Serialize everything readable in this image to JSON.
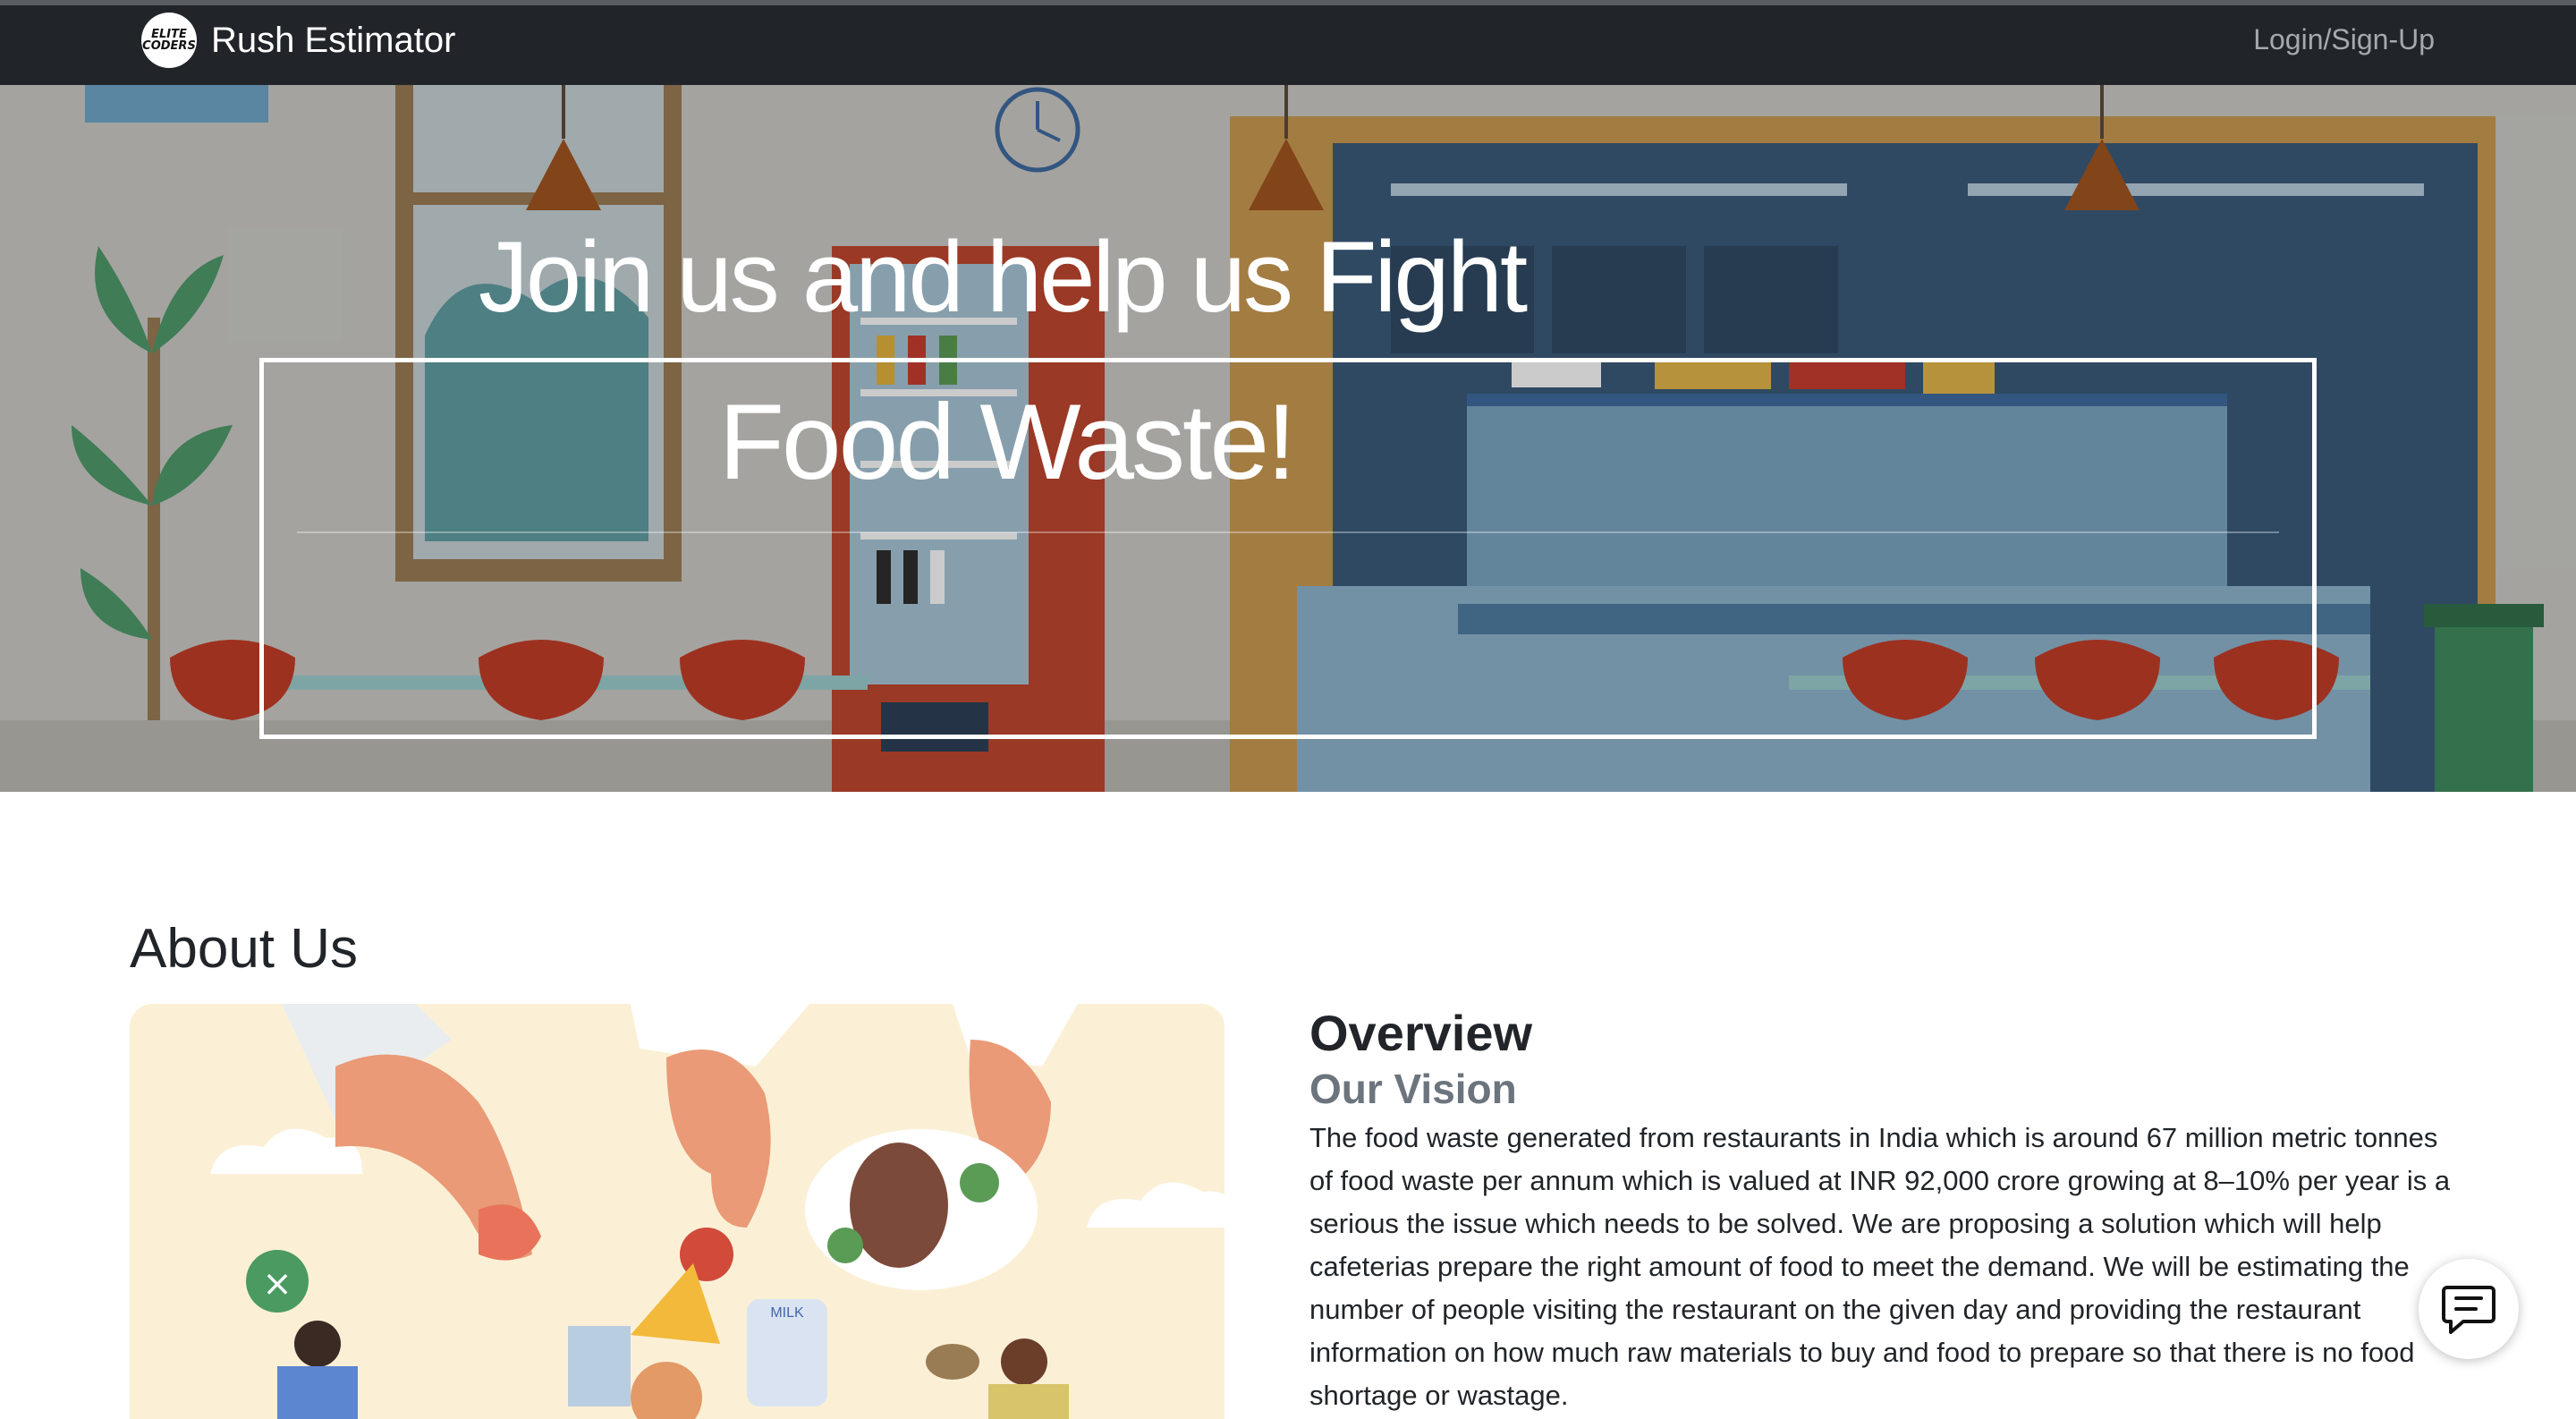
{
  "navbar": {
    "logo_text_top": "ELITE",
    "logo_text_bottom": "CODERS",
    "brand": "Rush Estimator",
    "login": "Login/Sign-Up"
  },
  "hero": {
    "line1": "Join us and help us Fight",
    "line2": "Food Waste!"
  },
  "about": {
    "title": "About Us",
    "overview_title": "Overview",
    "vision_title": "Our Vision",
    "vision_text": "The food waste generated from restaurants in India which is around 67 million metric tonnes of food waste per annum which is valued at INR 92,000 crore growing at 8–10% per year is a serious the issue which needs to be solved. We are proposing a solution which will help cafeterias prepare the right amount of food to meet the demand. We will be estimating the number of people visiting the restaurant on the given day and providing the restaurant information on how much raw materials to buy and food to prepare so that there is no food shortage or wastage.",
    "milk_label": "MILK"
  },
  "colors": {
    "navbar_bg": "#212529",
    "navbar_link": "#a5a9ad",
    "vision_gray": "#6c757d"
  },
  "icons": {
    "chat": "chat-icon",
    "logo": "elite-coders-logo"
  }
}
